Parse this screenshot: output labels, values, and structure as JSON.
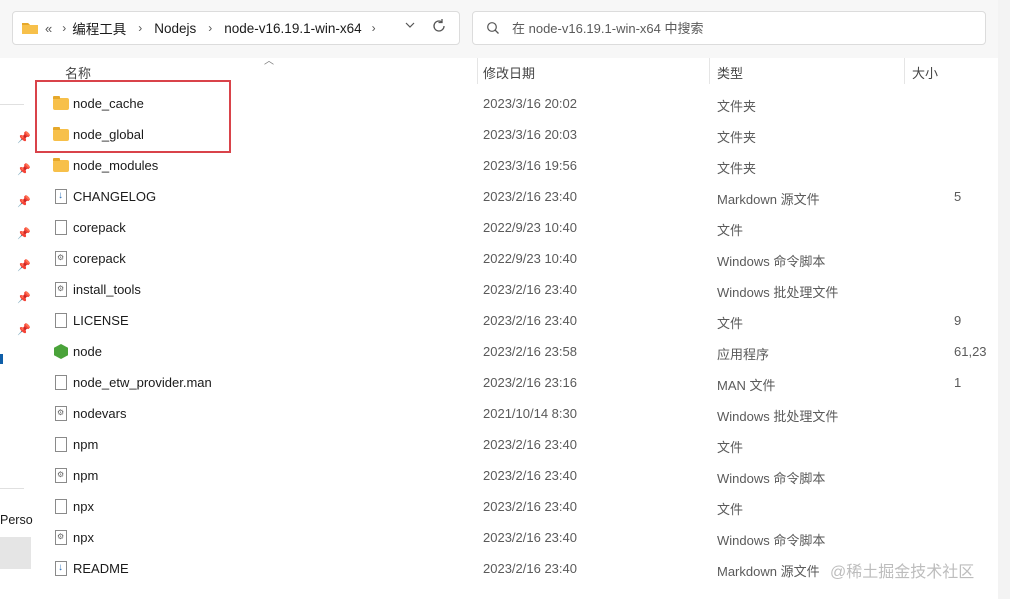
{
  "address_bar": {
    "overflow": "«",
    "breadcrumbs": [
      "编程工具",
      "Nodejs",
      "node-v16.19.1-win-x64"
    ],
    "separator": "›"
  },
  "search": {
    "placeholder": "在 node-v16.19.1-win-x64 中搜索"
  },
  "nav": {
    "partial_label": "Perso"
  },
  "columns": {
    "name": "名称",
    "date": "修改日期",
    "type": "类型",
    "size": "大小"
  },
  "files": [
    {
      "name": "node_cache",
      "date": "2023/3/16 20:02",
      "type": "文件夹",
      "size": "",
      "icon": "folder-icon"
    },
    {
      "name": "node_global",
      "date": "2023/3/16 20:03",
      "type": "文件夹",
      "size": "",
      "icon": "folder-icon"
    },
    {
      "name": "node_modules",
      "date": "2023/3/16 19:56",
      "type": "文件夹",
      "size": "",
      "icon": "folder-icon"
    },
    {
      "name": "CHANGELOG",
      "date": "2023/2/16 23:40",
      "type": "Markdown 源文件",
      "size": "5",
      "icon": "markdown-file-icon"
    },
    {
      "name": "corepack",
      "date": "2022/9/23 10:40",
      "type": "文件",
      "size": "",
      "icon": "file-icon"
    },
    {
      "name": "corepack",
      "date": "2022/9/23 10:40",
      "type": "Windows 命令脚本",
      "size": "",
      "icon": "script-file-icon"
    },
    {
      "name": "install_tools",
      "date": "2023/2/16 23:40",
      "type": "Windows 批处理文件",
      "size": "",
      "icon": "script-file-icon"
    },
    {
      "name": "LICENSE",
      "date": "2023/2/16 23:40",
      "type": "文件",
      "size": "9",
      "icon": "file-icon"
    },
    {
      "name": "node",
      "date": "2023/2/16 23:58",
      "type": "应用程序",
      "size": "61,23",
      "icon": "nodejs-app-icon"
    },
    {
      "name": "node_etw_provider.man",
      "date": "2023/2/16 23:16",
      "type": "MAN 文件",
      "size": "1",
      "icon": "file-icon"
    },
    {
      "name": "nodevars",
      "date": "2021/10/14 8:30",
      "type": "Windows 批处理文件",
      "size": "",
      "icon": "script-file-icon"
    },
    {
      "name": "npm",
      "date": "2023/2/16 23:40",
      "type": "文件",
      "size": "",
      "icon": "file-icon"
    },
    {
      "name": "npm",
      "date": "2023/2/16 23:40",
      "type": "Windows 命令脚本",
      "size": "",
      "icon": "script-file-icon"
    },
    {
      "name": "npx",
      "date": "2023/2/16 23:40",
      "type": "文件",
      "size": "",
      "icon": "file-icon"
    },
    {
      "name": "npx",
      "date": "2023/2/16 23:40",
      "type": "Windows 命令脚本",
      "size": "",
      "icon": "script-file-icon"
    },
    {
      "name": "README",
      "date": "2023/2/16 23:40",
      "type": "Markdown 源文件",
      "size": "",
      "icon": "markdown-file-icon"
    }
  ],
  "watermark": "@稀土掘金技术社区",
  "colors": {
    "highlight": "#d9434a",
    "folder": "#f7c04a",
    "accent": "#0f5ea8"
  }
}
